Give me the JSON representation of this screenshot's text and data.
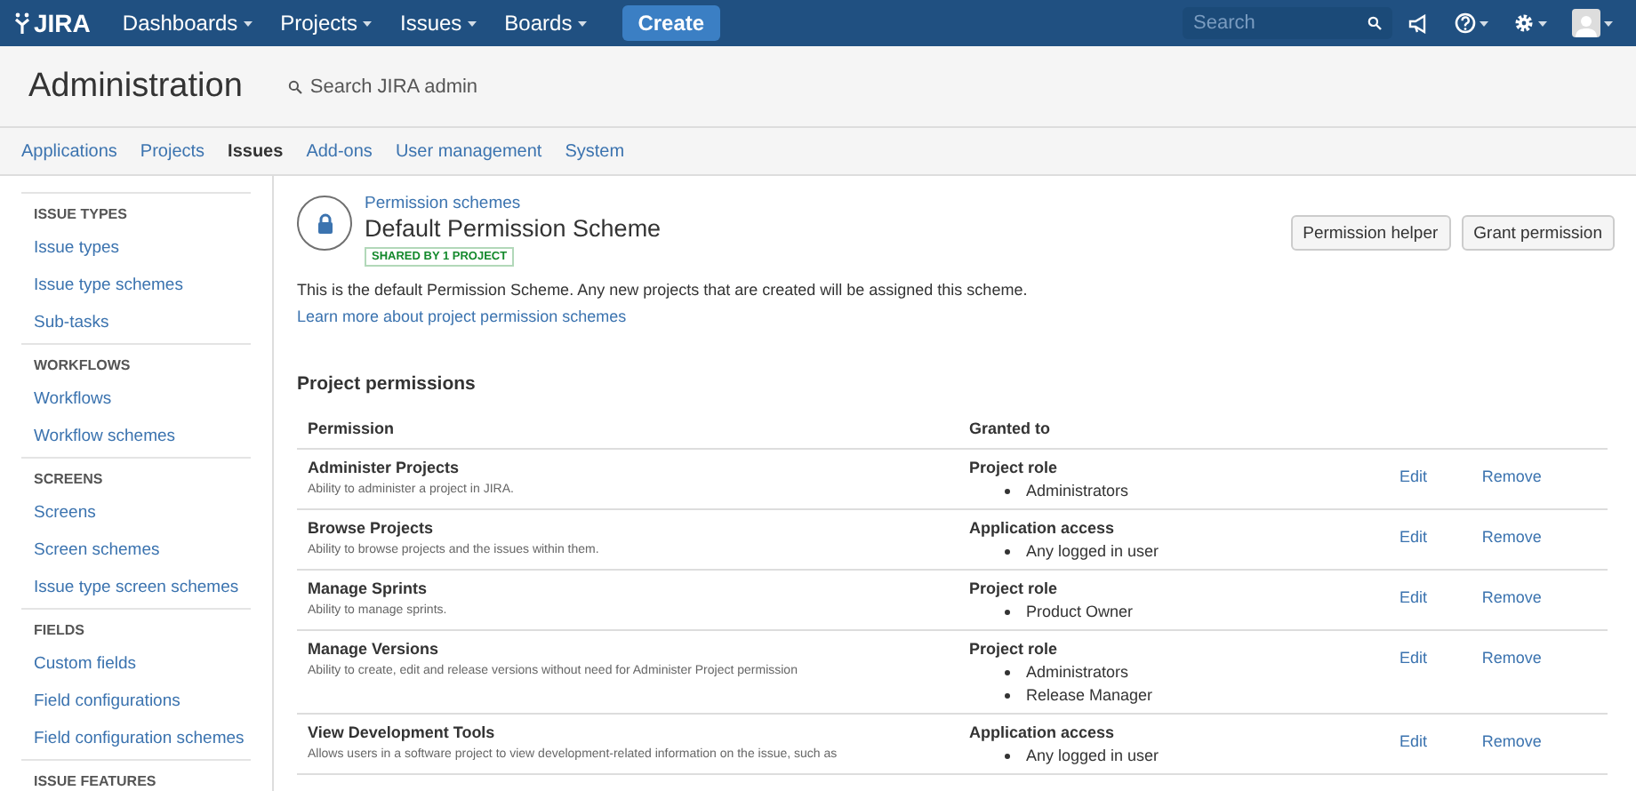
{
  "header": {
    "logo": "JIRA",
    "menus": [
      {
        "label": "Dashboards"
      },
      {
        "label": "Projects"
      },
      {
        "label": "Issues"
      },
      {
        "label": "Boards"
      }
    ],
    "create": "Create",
    "search": {
      "placeholder": "Search"
    }
  },
  "admin": {
    "title": "Administration",
    "search_placeholder": "Search JIRA admin"
  },
  "tabs": [
    {
      "label": "Applications",
      "selected": false
    },
    {
      "label": "Projects",
      "selected": false
    },
    {
      "label": "Issues",
      "selected": true
    },
    {
      "label": "Add-ons",
      "selected": false
    },
    {
      "label": "User management",
      "selected": false
    },
    {
      "label": "System",
      "selected": false
    }
  ],
  "sidebar": [
    {
      "heading": "ISSUE TYPES",
      "items": [
        "Issue types",
        "Issue type schemes",
        "Sub-tasks"
      ]
    },
    {
      "heading": "WORKFLOWS",
      "items": [
        "Workflows",
        "Workflow schemes"
      ]
    },
    {
      "heading": "SCREENS",
      "items": [
        "Screens",
        "Screen schemes",
        "Issue type screen schemes"
      ]
    },
    {
      "heading": "FIELDS",
      "items": [
        "Custom fields",
        "Field configurations",
        "Field configuration schemes"
      ]
    },
    {
      "heading": "ISSUE FEATURES"
    }
  ],
  "scheme": {
    "breadcrumb": "Permission schemes",
    "title": "Default Permission Scheme",
    "badge": "SHARED BY 1 PROJECT",
    "buttons": [
      "Permission helper",
      "Grant permission"
    ],
    "description": "This is the default Permission Scheme. Any new projects that are created will be assigned this scheme.",
    "learn_more": "Learn more about project permission schemes"
  },
  "permissions": {
    "title": "Project permissions",
    "columns": [
      "Permission",
      "Granted to"
    ],
    "rows": [
      {
        "name": "Administer Projects",
        "description": "Ability to administer a project in JIRA.",
        "grant_type": "Project role",
        "grantees": [
          "Administrators"
        ],
        "actions": [
          "Edit",
          "Remove"
        ]
      },
      {
        "name": "Browse Projects",
        "description": "Ability to browse projects and the issues within them.",
        "grant_type": "Application access",
        "grantees": [
          "Any logged in user"
        ],
        "actions": [
          "Edit",
          "Remove"
        ]
      },
      {
        "name": "Manage Sprints",
        "description": "Ability to manage sprints.",
        "grant_type": "Project role",
        "grantees": [
          "Product Owner"
        ],
        "actions": [
          "Edit",
          "Remove"
        ]
      },
      {
        "name": "Manage Versions",
        "description": "Ability to create, edit and release versions without need for Administer Project permission",
        "grant_type": "Project role",
        "grantees": [
          "Administrators",
          "Release Manager"
        ],
        "actions": [
          "Edit",
          "Remove"
        ]
      },
      {
        "name": "View Development Tools",
        "description": "Allows users in a software project to view development-related information on the issue, such as",
        "grant_type": "Application access",
        "grantees": [
          "Any logged in user"
        ],
        "actions": [
          "Edit",
          "Remove"
        ]
      }
    ]
  }
}
